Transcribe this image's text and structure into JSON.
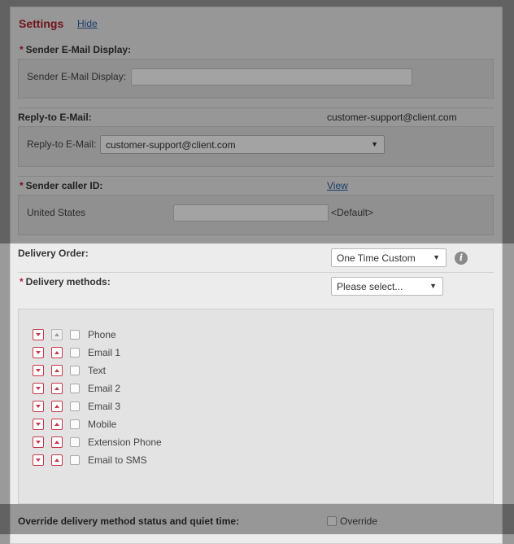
{
  "settings": {
    "title": "Settings",
    "hide_link": "Hide"
  },
  "sender_email": {
    "header": "Sender E-Mail Display:",
    "field_label": "Sender E-Mail Display:",
    "value": ""
  },
  "reply_to": {
    "header": "Reply-to E-Mail:",
    "current_value": "customer-support@client.com",
    "field_label": "Reply-to E-Mail:",
    "selected": "customer-support@client.com"
  },
  "caller_id": {
    "header": "Sender caller ID:",
    "view_link": "View",
    "country": "United States",
    "value": "",
    "default_text": "<Default>"
  },
  "delivery_order": {
    "label": "Delivery Order:",
    "selected": "One Time Custom"
  },
  "delivery_methods": {
    "label": "Delivery methods:",
    "selected": "Please select...",
    "items": [
      {
        "label": "Phone"
      },
      {
        "label": "Email 1"
      },
      {
        "label": "Text"
      },
      {
        "label": "Email 2"
      },
      {
        "label": "Email 3"
      },
      {
        "label": "Mobile"
      },
      {
        "label": "Extension Phone"
      },
      {
        "label": "Email to SMS"
      }
    ]
  },
  "override": {
    "label": "Override delivery method status and quiet time:",
    "checkbox_label": "Override"
  },
  "colors": {
    "title_red": "#b01e2d",
    "link_blue": "#2a5fa8",
    "overlay": "rgba(0,0,0,0.36)"
  }
}
